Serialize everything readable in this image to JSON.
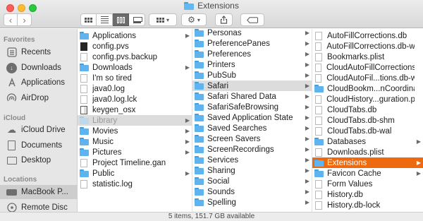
{
  "window": {
    "title": "Extensions"
  },
  "toolbar": {
    "nav_back": "‹",
    "nav_forward": "›",
    "action_caret": "▾",
    "group_caret": "▾"
  },
  "sidebar": {
    "sections": [
      {
        "heading": "Favorites",
        "items": [
          {
            "label": "Recents",
            "icon": "clock-icon"
          },
          {
            "label": "Downloads",
            "icon": "download-icon"
          },
          {
            "label": "Applications",
            "icon": "applications-icon"
          },
          {
            "label": "AirDrop",
            "icon": "airdrop-icon"
          }
        ]
      },
      {
        "heading": "iCloud",
        "items": [
          {
            "label": "iCloud Drive",
            "icon": "cloud-icon"
          },
          {
            "label": "Documents",
            "icon": "document-icon"
          },
          {
            "label": "Desktop",
            "icon": "desktop-icon"
          }
        ]
      },
      {
        "heading": "Locations",
        "items": [
          {
            "label": "MacBook P...",
            "icon": "laptop-icon",
            "selected": true
          },
          {
            "label": "Remote Disc",
            "icon": "disc-icon"
          }
        ]
      }
    ]
  },
  "column1": [
    {
      "label": "Applications",
      "kind": "folder",
      "chevron": true
    },
    {
      "label": "config.pvs",
      "kind": "doc-dark"
    },
    {
      "label": "config.pvs.backup",
      "kind": "doc"
    },
    {
      "label": "Downloads",
      "kind": "folder",
      "chevron": true
    },
    {
      "label": "I'm so tired",
      "kind": "doc"
    },
    {
      "label": "java0.log",
      "kind": "doc"
    },
    {
      "label": "java0.log.lck",
      "kind": "doc"
    },
    {
      "label": "keygen_osx",
      "kind": "doc-bw"
    },
    {
      "label": "Library",
      "kind": "folder-faded",
      "chevron": true,
      "selected": "gray"
    },
    {
      "label": "Movies",
      "kind": "folder",
      "chevron": true
    },
    {
      "label": "Music",
      "kind": "folder",
      "chevron": true
    },
    {
      "label": "Pictures",
      "kind": "folder",
      "chevron": true
    },
    {
      "label": "Project Timeline.gan",
      "kind": "doc"
    },
    {
      "label": "Public",
      "kind": "folder",
      "chevron": true
    },
    {
      "label": "statistic.log",
      "kind": "doc"
    }
  ],
  "column2": [
    {
      "label": "Personas",
      "kind": "folder",
      "chevron": true
    },
    {
      "label": "PreferencePanes",
      "kind": "folder",
      "chevron": true
    },
    {
      "label": "Preferences",
      "kind": "folder",
      "chevron": true
    },
    {
      "label": "Printers",
      "kind": "folder",
      "chevron": true
    },
    {
      "label": "PubSub",
      "kind": "folder",
      "chevron": true
    },
    {
      "label": "Safari",
      "kind": "folder",
      "chevron": true,
      "selected": "gray-dark"
    },
    {
      "label": "Safari Shared Data",
      "kind": "folder",
      "chevron": true
    },
    {
      "label": "SafariSafeBrowsing",
      "kind": "folder",
      "chevron": true
    },
    {
      "label": "Saved Application State",
      "kind": "folder",
      "chevron": true
    },
    {
      "label": "Saved Searches",
      "kind": "folder",
      "chevron": true
    },
    {
      "label": "Screen Savers",
      "kind": "folder",
      "chevron": true
    },
    {
      "label": "ScreenRecordings",
      "kind": "folder",
      "chevron": true
    },
    {
      "label": "Services",
      "kind": "folder",
      "chevron": true
    },
    {
      "label": "Sharing",
      "kind": "folder",
      "chevron": true
    },
    {
      "label": "Social",
      "kind": "folder",
      "chevron": true
    },
    {
      "label": "Sounds",
      "kind": "folder",
      "chevron": true
    },
    {
      "label": "Spelling",
      "kind": "folder",
      "chevron": true
    }
  ],
  "column3": [
    {
      "label": "AutoFillCorrections.db",
      "kind": "doc"
    },
    {
      "label": "AutoFillCorrections.db-wal",
      "kind": "doc"
    },
    {
      "label": "Bookmarks.plist",
      "kind": "doc"
    },
    {
      "label": "CloudAutoFillCorrections.db",
      "kind": "doc"
    },
    {
      "label": "CloudAutoFil...tions.db-wal",
      "kind": "doc"
    },
    {
      "label": "CloudBookm...nCoordinator",
      "kind": "folder"
    },
    {
      "label": "CloudHistory...guration.plist",
      "kind": "doc"
    },
    {
      "label": "CloudTabs.db",
      "kind": "doc"
    },
    {
      "label": "CloudTabs.db-shm",
      "kind": "doc"
    },
    {
      "label": "CloudTabs.db-wal",
      "kind": "doc"
    },
    {
      "label": "Databases",
      "kind": "folder",
      "chevron": true
    },
    {
      "label": "Downloads.plist",
      "kind": "doc"
    },
    {
      "label": "Extensions",
      "kind": "folder",
      "chevron": true,
      "selected": "active"
    },
    {
      "label": "Favicon Cache",
      "kind": "folder",
      "chevron": true
    },
    {
      "label": "Form Values",
      "kind": "doc"
    },
    {
      "label": "History.db",
      "kind": "doc"
    },
    {
      "label": "History.db-lock",
      "kind": "doc"
    }
  ],
  "status": {
    "text": "5 items, 151.7 GB available"
  },
  "colors": {
    "selection_active": "#ed6a10",
    "folder": "#5fb4ef",
    "sidebar_bg": "#e6e6e6"
  }
}
